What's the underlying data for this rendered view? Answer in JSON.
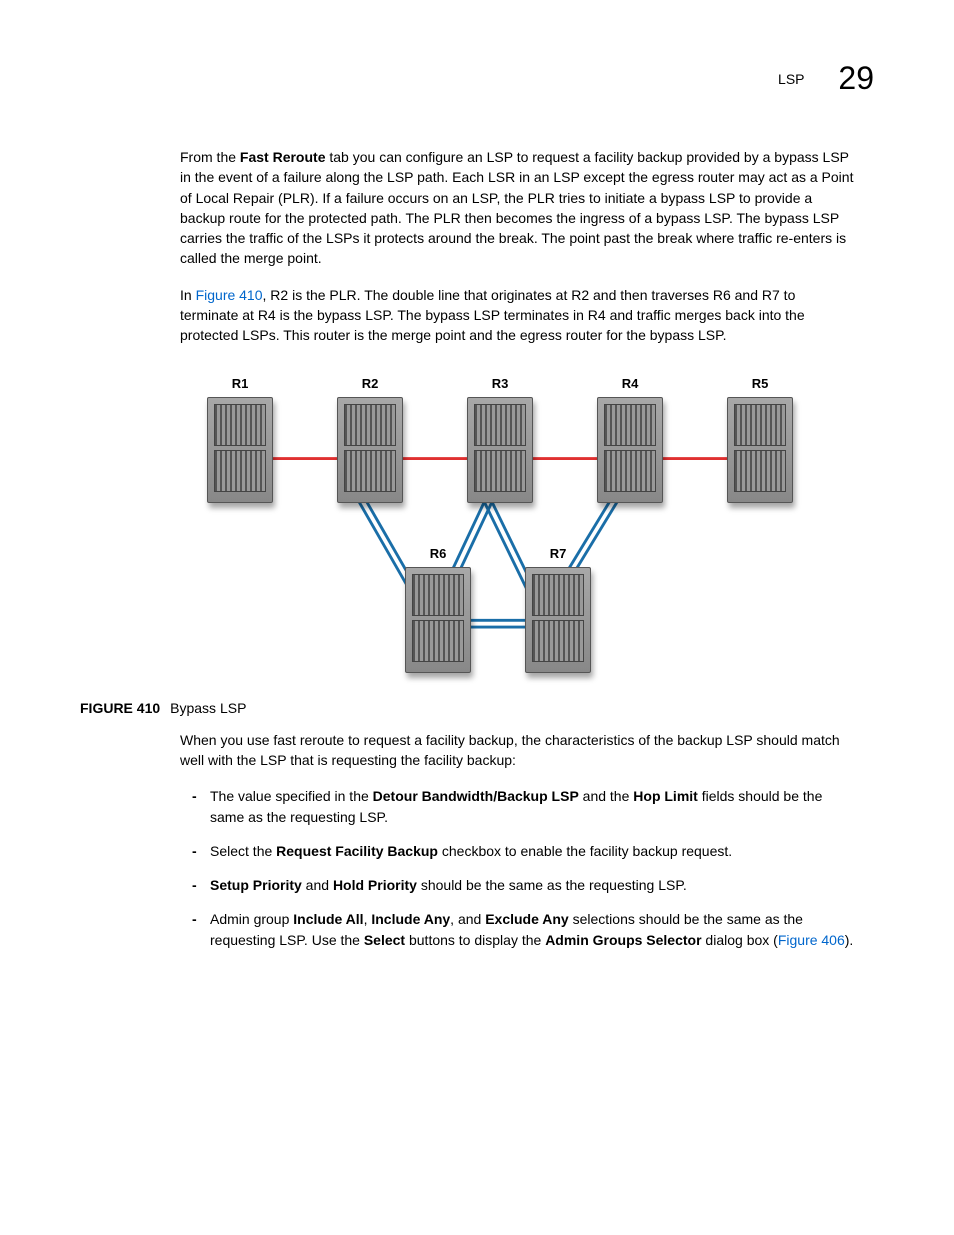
{
  "header": {
    "section": "LSP",
    "chapter": "29"
  },
  "para1": {
    "pre": "From the ",
    "bold1": "Fast Reroute",
    "post": " tab you can configure an LSP to request a facility backup provided by a bypass LSP in the event of a failure along the LSP path. Each LSR in an LSP except the egress router may act as a Point of Local Repair (PLR). If a failure occurs on an LSP, the PLR tries to initiate a bypass LSP to provide a backup route for the protected path. The PLR then becomes the ingress of a bypass LSP. The bypass LSP carries the traffic of the LSPs it protects around the break. The point past the break where traffic re-enters is called the merge point."
  },
  "para2": {
    "pre": "In ",
    "link": "Figure 410",
    "post": ", R2 is the PLR. The double line that originates at R2 and then traverses R6 and R7 to terminate at R4 is the bypass LSP. The bypass LSP terminates in R4 and traffic merges back into the protected LSPs. This router is the merge point and the egress router for the bypass LSP."
  },
  "routers": {
    "r1": "R1",
    "r2": "R2",
    "r3": "R3",
    "r4": "R4",
    "r5": "R5",
    "r6": "R6",
    "r7": "R7"
  },
  "figcap": {
    "num": "FIGURE 410",
    "title": "Bypass LSP"
  },
  "para3": "When you use fast reroute to request a facility backup, the characteristics of the backup LSP should match well with the LSP that is requesting the facility backup:",
  "bullets": {
    "b1": {
      "a": "The value specified in the ",
      "b": "Detour Bandwidth/Backup LSP",
      "c": " and the ",
      "d": "Hop Limit",
      "e": " fields should be the same as the requesting LSP."
    },
    "b2": {
      "a": "Select the ",
      "b": "Request Facility Backup",
      "c": " checkbox to enable the facility backup request."
    },
    "b3": {
      "a": "Setup Priority",
      "b": " and ",
      "c": "Hold Priority",
      "d": " should be the same as the requesting LSP."
    },
    "b4": {
      "a": "Admin group ",
      "b": "Include All",
      "c": ", ",
      "d": "Include Any",
      "e": ", and ",
      "f": "Exclude Any",
      "g": " selections should be the same as the requesting LSP. Use the ",
      "h": "Select",
      "i": " buttons to display the ",
      "j": "Admin Groups Selector",
      "k": " dialog box (",
      "l": "Figure 406",
      "m": ")."
    }
  }
}
